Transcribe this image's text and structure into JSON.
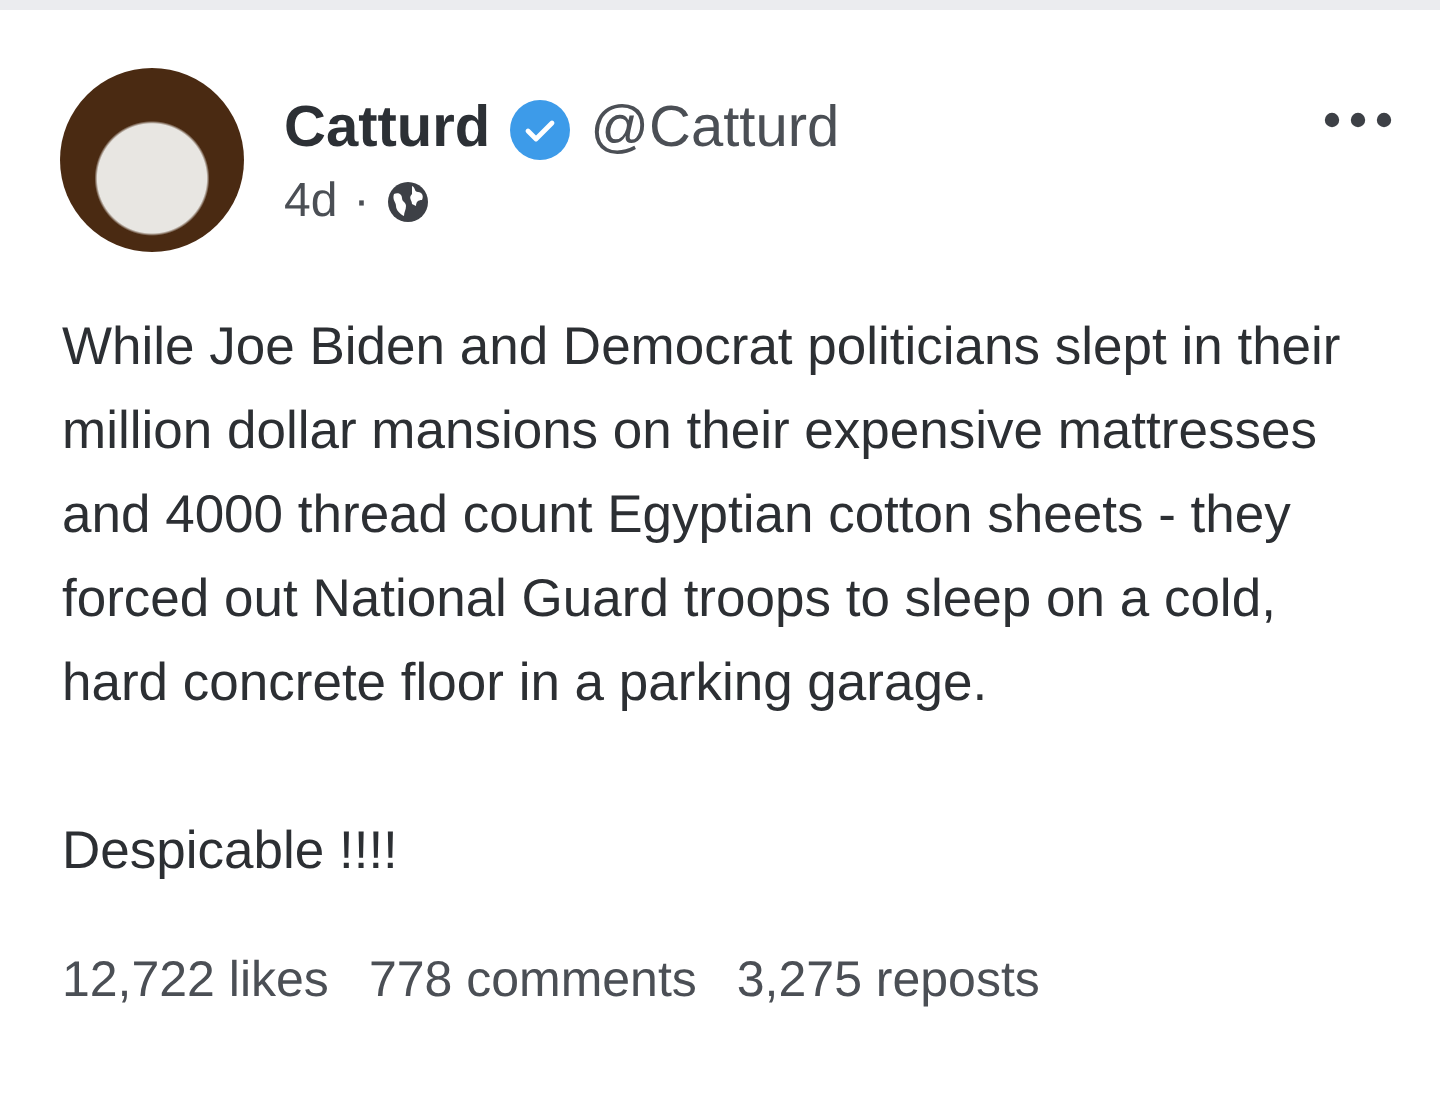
{
  "post": {
    "author": {
      "name": "Catturd",
      "verified": true,
      "handle": "@Catturd"
    },
    "time": "4d",
    "separator": "·",
    "body": "While Joe Biden and Democrat politicians slept in their million dollar mansions on their expensive mattresses and 4000 thread count Egyptian cotton sheets - they forced out National Guard troops to sleep on a cold, hard concrete floor in a parking garage.",
    "closing": "Despicable !!!!",
    "stats": [
      "12,722 likes",
      "778 comments",
      "3,275 reposts"
    ]
  }
}
